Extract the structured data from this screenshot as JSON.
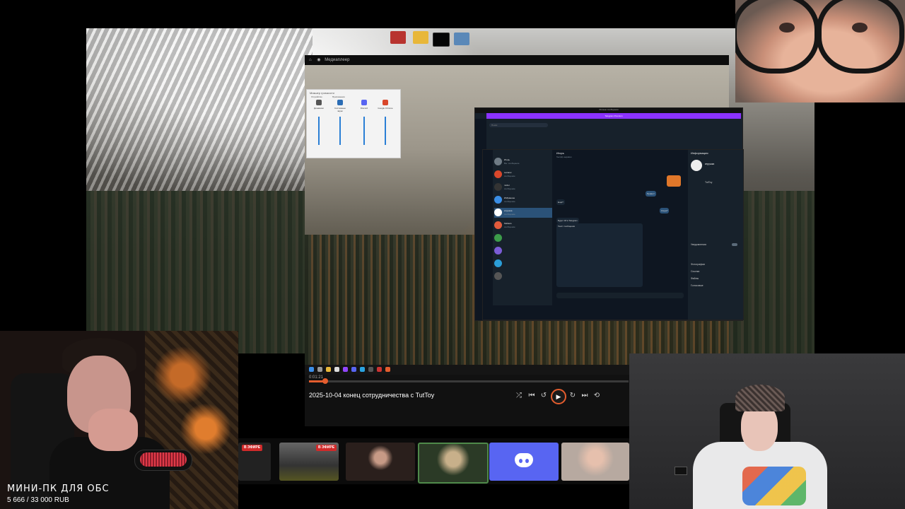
{
  "overlay": {
    "title": "МИНИ-ПК ДЛЯ ОБС",
    "goal": "5 666 / 33 000 RUB"
  },
  "player": {
    "app_title": "Медиаплеер",
    "time": "0:01:21",
    "video_title": "2025-10-04 конец сотрудничества с TutToy",
    "progress_fraction": 0.05,
    "accent_color": "#e45d2e"
  },
  "mixer": {
    "title": "Микшер громкости",
    "devices_label": "Устройство",
    "apps_label": "Приложения",
    "columns": [
      "Динамики",
      "Системные звуки",
      "Discord",
      "Google Chrome"
    ]
  },
  "telegram": {
    "window_title": "Личные сообщения",
    "banner": "Telegram Premium",
    "search_placeholder": "Поиск",
    "chat_name": "Игорь",
    "chat_status": "был(а) недавно",
    "chats": [
      {
        "name": "Игорь",
        "preview": "Вы: сообщение"
      },
      {
        "name": "Lazarev",
        "preview": "сообщение"
      },
      {
        "name": "mrdoi",
        "preview": "сообщение"
      },
      {
        "name": "Избранное",
        "preview": "сообщение"
      },
      {
        "name": "игрушка",
        "preview": "сообщение"
      },
      {
        "name": "Stickers",
        "preview": "сообщение"
      }
    ],
    "messages": [
      {
        "dir": "out",
        "text": "Привет!"
      },
      {
        "dir": "in",
        "text": "Ещё?"
      },
      {
        "dir": "out",
        "text": "Когда?"
      },
      {
        "dir": "in",
        "text": "Будет 18 в Telegram"
      },
      {
        "dir": "in",
        "text": "Текст сообщения"
      }
    ],
    "info_title": "Информация",
    "info_name": "игрушка",
    "info_link": "TutToy",
    "notifications": "Уведомления",
    "tabs": [
      "Фотографии",
      "Ссылки",
      "Файлы",
      "Голосовые"
    ],
    "brand_color": "#8b32ff"
  },
  "stream_tiles": {
    "live_badge": "В ЭФИРЕ",
    "discord_color": "#5865f2"
  }
}
